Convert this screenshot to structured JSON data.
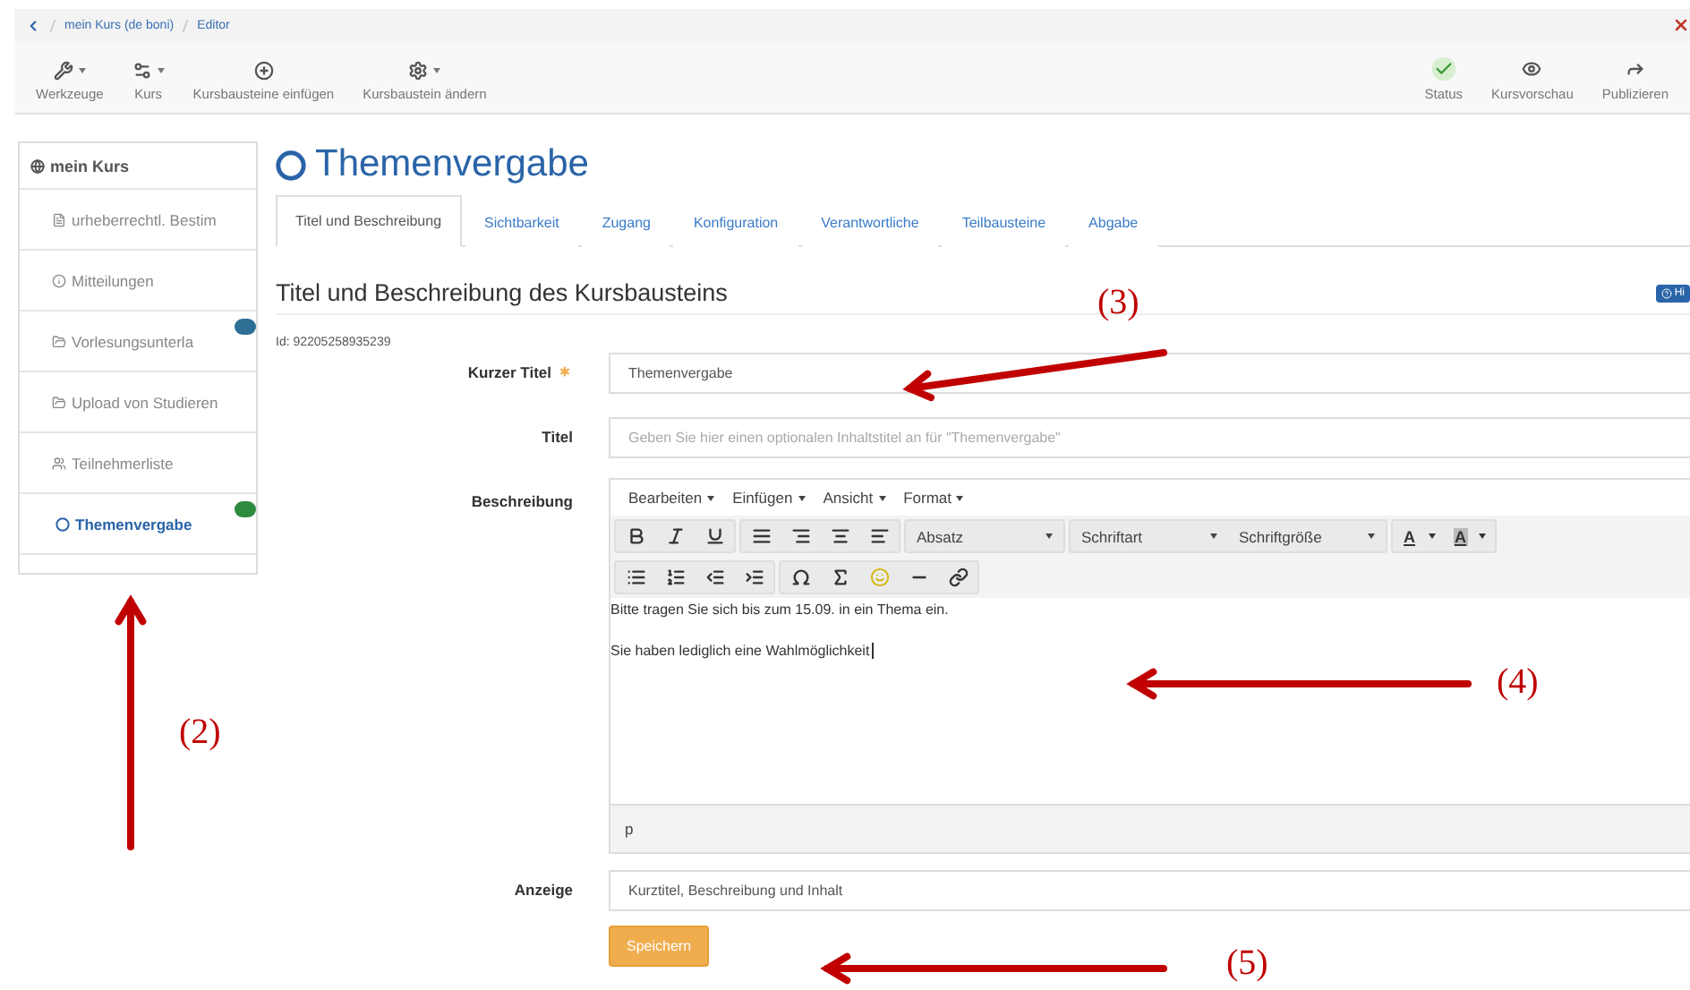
{
  "breadcrumb": [
    "mein Kurs (de boni)",
    "Editor"
  ],
  "toolbar_left": [
    {
      "label": "Werkzeuge",
      "caret": true
    },
    {
      "label": "Kurs",
      "caret": true
    },
    {
      "label": "Kursbausteine einfügen",
      "caret": false
    },
    {
      "label": "Kursbaustein ändern",
      "caret": true
    }
  ],
  "toolbar_right": [
    {
      "label": "Status"
    },
    {
      "label": "Kursvorschau"
    },
    {
      "label": "Publizieren"
    }
  ],
  "sidebar": {
    "root": "mein Kurs",
    "items": [
      {
        "label": "urheberrechtl. Bestim",
        "selected": false
      },
      {
        "label": "Mitteilungen",
        "selected": false
      },
      {
        "label": "Vorlesungsunterla",
        "selected": false,
        "color": "#2f6f95"
      },
      {
        "label": "Upload von Studieren",
        "selected": false
      },
      {
        "label": "Teilnehmerliste",
        "selected": false
      },
      {
        "label": "Themenvergabe",
        "selected": true,
        "color": "#2e8b3e"
      }
    ]
  },
  "page_title": "Themenvergabe",
  "tabs": [
    {
      "label": "Titel und Beschreibung",
      "selected": true
    },
    {
      "label": "Sichtbarkeit",
      "selected": false
    },
    {
      "label": "Zugang",
      "selected": false
    },
    {
      "label": "Konfiguration",
      "selected": false
    },
    {
      "label": "Verantwortliche",
      "selected": false
    },
    {
      "label": "Teilbausteine",
      "selected": false
    },
    {
      "label": "Abgabe",
      "selected": false
    }
  ],
  "section_title": "Titel und Beschreibung des Kursbausteins",
  "help_button": "Hi",
  "id_text": "Id: 92205258935239",
  "form": {
    "short_title": {
      "label": "Kurzer Titel",
      "value": "Themenvergabe",
      "required": true
    },
    "title": {
      "label": "Titel",
      "placeholder": "Geben Sie hier einen optionalen Inhaltstitel an für \"Themenvergabe\""
    },
    "description": {
      "label": "Beschreibung",
      "menus": [
        "Bearbeiten",
        "Einfügen",
        "Ansicht",
        "Format"
      ],
      "selects": [
        "Absatz",
        "Schriftart",
        "Schriftgröße"
      ],
      "color_buttons": [
        "A",
        "A"
      ],
      "paragraphs": [
        "Bitte tragen Sie sich bis zum 15.09. in ein Thema ein.",
        "Sie haben lediglich eine Wahlmöglichkeit"
      ],
      "path": "p"
    },
    "display": {
      "label": "Anzeige",
      "value": "Kurztitel, Beschreibung und Inhalt"
    },
    "save": "Speichern"
  },
  "annotations": [
    "(2)",
    "(3)",
    "(4)",
    "(5)"
  ]
}
